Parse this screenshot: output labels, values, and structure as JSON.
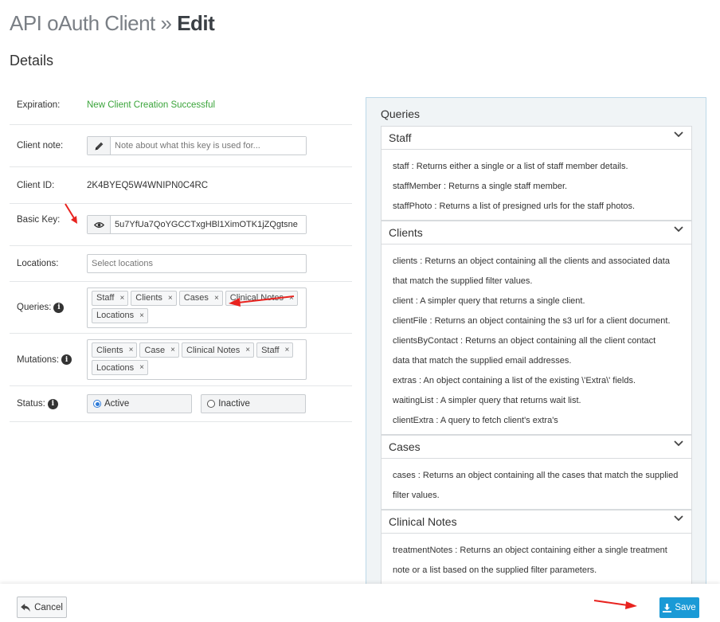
{
  "header": {
    "title_prefix": "API oAuth Client »",
    "title_action": "Edit"
  },
  "section": {
    "title": "Details"
  },
  "form": {
    "expiration": {
      "label": "Expiration:",
      "value": "New Client Creation Successful"
    },
    "client_note": {
      "label": "Client note:",
      "placeholder": "Note about what this key is used for..."
    },
    "client_id": {
      "label": "Client ID:",
      "value": "2K4BYEQ5W4WNIPN0C4RC"
    },
    "basic_key": {
      "label": "Basic Key:",
      "value": "5u7YfUa7QoYGCCTxgHBl1XimOTK1jZQgtsne"
    },
    "locations": {
      "label": "Locations:",
      "placeholder": "Select locations"
    },
    "queries": {
      "label": "Queries:",
      "tags": [
        "Staff",
        "Clients",
        "Cases",
        "Clinical Notes",
        "Locations"
      ]
    },
    "mutations": {
      "label": "Mutations:",
      "tags": [
        "Clients",
        "Case",
        "Clinical Notes",
        "Staff",
        "Locations"
      ]
    },
    "status": {
      "label": "Status:",
      "options": [
        "Active",
        "Inactive"
      ],
      "selected": "Active"
    }
  },
  "queries_panel": {
    "title": "Queries",
    "groups": [
      {
        "name": "Staff",
        "lines": [
          "staff : Returns either a single or a list of staff member details.",
          "staffMember : Returns a single staff member.",
          "staffPhoto : Returns a list of presigned urls for the staff photos."
        ]
      },
      {
        "name": "Clients",
        "lines": [
          "clients : Returns an object containing all the clients and associated data",
          "that match the supplied filter values.",
          "client : A simpler query that returns a single client.",
          "clientFile : Returns an object containing the s3 url for a client document.",
          "clientsByContact : Returns an object containing all the client contact",
          "data that match the supplied email addresses.",
          "extras : An object containing a list of the existing \\'Extra\\' fields.",
          "waitingList : A simpler query that returns wait list.",
          "clientExtra : A query to fetch client's extra's"
        ]
      },
      {
        "name": "Cases",
        "lines": [
          "cases : Returns an object containing all the cases that match the supplied",
          "filter values."
        ]
      },
      {
        "name": "Clinical Notes",
        "lines": [
          "treatmentNotes : Returns an object containing either a single treatment",
          "note or a list based on the supplied filter parameters."
        ]
      }
    ]
  },
  "footer": {
    "cancel_label": "Cancel",
    "save_label": "Save"
  },
  "colors": {
    "primary": "#1a9ad6",
    "success": "#3aa43a",
    "annotation": "#e8231f"
  }
}
